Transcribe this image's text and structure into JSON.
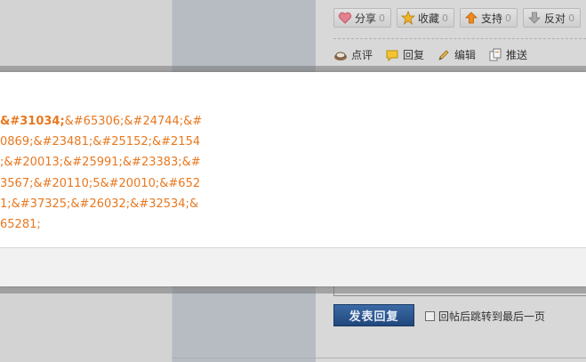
{
  "actions": [
    {
      "label": "分享",
      "count": "0",
      "icon": "heart-icon"
    },
    {
      "label": "收藏",
      "count": "0",
      "icon": "star-icon"
    },
    {
      "label": "支持",
      "count": "0",
      "icon": "arrow-up-icon"
    },
    {
      "label": "反对",
      "count": "0",
      "icon": "arrow-down-icon"
    }
  ],
  "tools": [
    {
      "label": "点评",
      "icon": "coffee-cup-icon"
    },
    {
      "label": "回复",
      "icon": "speech-bubble-icon"
    },
    {
      "label": "编辑",
      "icon": "pencil-icon"
    },
    {
      "label": "推送",
      "icon": "document-icon"
    }
  ],
  "reply": {
    "submit_label": "发表回复",
    "jump_label": "回帖后跳转到最后一页"
  },
  "dialog": {
    "message_bold": "&#31034;",
    "message_lines": [
      "&#65306;&#24744;&#",
      "0869;&#23481;&#25152;&#2154",
      ";&#20013;&#25991;&#23383;&#",
      "3567;&#20110;5&#20010;&#652",
      "1;&#37325;&#26032;&#32534;&",
      "65281;"
    ]
  },
  "colors": {
    "message": "#e8781f",
    "submit_bg": "#2a5590"
  }
}
